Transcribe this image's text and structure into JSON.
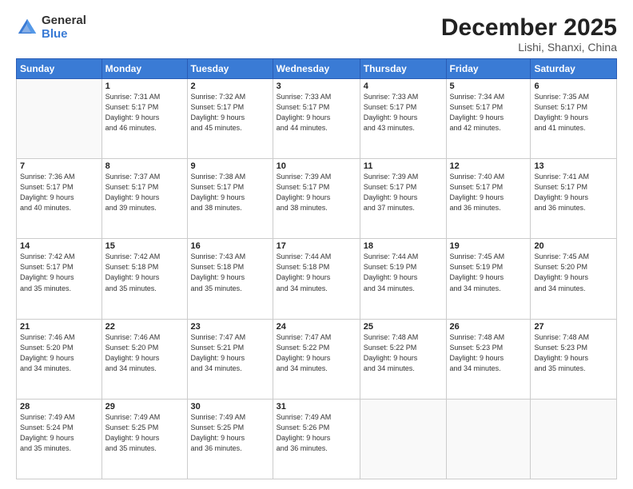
{
  "header": {
    "logo_general": "General",
    "logo_blue": "Blue",
    "month_title": "December 2025",
    "subtitle": "Lishi, Shanxi, China"
  },
  "days_of_week": [
    "Sunday",
    "Monday",
    "Tuesday",
    "Wednesday",
    "Thursday",
    "Friday",
    "Saturday"
  ],
  "weeks": [
    [
      {
        "day": "",
        "info": ""
      },
      {
        "day": "1",
        "info": "Sunrise: 7:31 AM\nSunset: 5:17 PM\nDaylight: 9 hours\nand 46 minutes."
      },
      {
        "day": "2",
        "info": "Sunrise: 7:32 AM\nSunset: 5:17 PM\nDaylight: 9 hours\nand 45 minutes."
      },
      {
        "day": "3",
        "info": "Sunrise: 7:33 AM\nSunset: 5:17 PM\nDaylight: 9 hours\nand 44 minutes."
      },
      {
        "day": "4",
        "info": "Sunrise: 7:33 AM\nSunset: 5:17 PM\nDaylight: 9 hours\nand 43 minutes."
      },
      {
        "day": "5",
        "info": "Sunrise: 7:34 AM\nSunset: 5:17 PM\nDaylight: 9 hours\nand 42 minutes."
      },
      {
        "day": "6",
        "info": "Sunrise: 7:35 AM\nSunset: 5:17 PM\nDaylight: 9 hours\nand 41 minutes."
      }
    ],
    [
      {
        "day": "7",
        "info": "Sunrise: 7:36 AM\nSunset: 5:17 PM\nDaylight: 9 hours\nand 40 minutes."
      },
      {
        "day": "8",
        "info": "Sunrise: 7:37 AM\nSunset: 5:17 PM\nDaylight: 9 hours\nand 39 minutes."
      },
      {
        "day": "9",
        "info": "Sunrise: 7:38 AM\nSunset: 5:17 PM\nDaylight: 9 hours\nand 38 minutes."
      },
      {
        "day": "10",
        "info": "Sunrise: 7:39 AM\nSunset: 5:17 PM\nDaylight: 9 hours\nand 38 minutes."
      },
      {
        "day": "11",
        "info": "Sunrise: 7:39 AM\nSunset: 5:17 PM\nDaylight: 9 hours\nand 37 minutes."
      },
      {
        "day": "12",
        "info": "Sunrise: 7:40 AM\nSunset: 5:17 PM\nDaylight: 9 hours\nand 36 minutes."
      },
      {
        "day": "13",
        "info": "Sunrise: 7:41 AM\nSunset: 5:17 PM\nDaylight: 9 hours\nand 36 minutes."
      }
    ],
    [
      {
        "day": "14",
        "info": "Sunrise: 7:42 AM\nSunset: 5:17 PM\nDaylight: 9 hours\nand 35 minutes."
      },
      {
        "day": "15",
        "info": "Sunrise: 7:42 AM\nSunset: 5:18 PM\nDaylight: 9 hours\nand 35 minutes."
      },
      {
        "day": "16",
        "info": "Sunrise: 7:43 AM\nSunset: 5:18 PM\nDaylight: 9 hours\nand 35 minutes."
      },
      {
        "day": "17",
        "info": "Sunrise: 7:44 AM\nSunset: 5:18 PM\nDaylight: 9 hours\nand 34 minutes."
      },
      {
        "day": "18",
        "info": "Sunrise: 7:44 AM\nSunset: 5:19 PM\nDaylight: 9 hours\nand 34 minutes."
      },
      {
        "day": "19",
        "info": "Sunrise: 7:45 AM\nSunset: 5:19 PM\nDaylight: 9 hours\nand 34 minutes."
      },
      {
        "day": "20",
        "info": "Sunrise: 7:45 AM\nSunset: 5:20 PM\nDaylight: 9 hours\nand 34 minutes."
      }
    ],
    [
      {
        "day": "21",
        "info": "Sunrise: 7:46 AM\nSunset: 5:20 PM\nDaylight: 9 hours\nand 34 minutes."
      },
      {
        "day": "22",
        "info": "Sunrise: 7:46 AM\nSunset: 5:20 PM\nDaylight: 9 hours\nand 34 minutes."
      },
      {
        "day": "23",
        "info": "Sunrise: 7:47 AM\nSunset: 5:21 PM\nDaylight: 9 hours\nand 34 minutes."
      },
      {
        "day": "24",
        "info": "Sunrise: 7:47 AM\nSunset: 5:22 PM\nDaylight: 9 hours\nand 34 minutes."
      },
      {
        "day": "25",
        "info": "Sunrise: 7:48 AM\nSunset: 5:22 PM\nDaylight: 9 hours\nand 34 minutes."
      },
      {
        "day": "26",
        "info": "Sunrise: 7:48 AM\nSunset: 5:23 PM\nDaylight: 9 hours\nand 34 minutes."
      },
      {
        "day": "27",
        "info": "Sunrise: 7:48 AM\nSunset: 5:23 PM\nDaylight: 9 hours\nand 35 minutes."
      }
    ],
    [
      {
        "day": "28",
        "info": "Sunrise: 7:49 AM\nSunset: 5:24 PM\nDaylight: 9 hours\nand 35 minutes."
      },
      {
        "day": "29",
        "info": "Sunrise: 7:49 AM\nSunset: 5:25 PM\nDaylight: 9 hours\nand 35 minutes."
      },
      {
        "day": "30",
        "info": "Sunrise: 7:49 AM\nSunset: 5:25 PM\nDaylight: 9 hours\nand 36 minutes."
      },
      {
        "day": "31",
        "info": "Sunrise: 7:49 AM\nSunset: 5:26 PM\nDaylight: 9 hours\nand 36 minutes."
      },
      {
        "day": "",
        "info": ""
      },
      {
        "day": "",
        "info": ""
      },
      {
        "day": "",
        "info": ""
      }
    ]
  ]
}
